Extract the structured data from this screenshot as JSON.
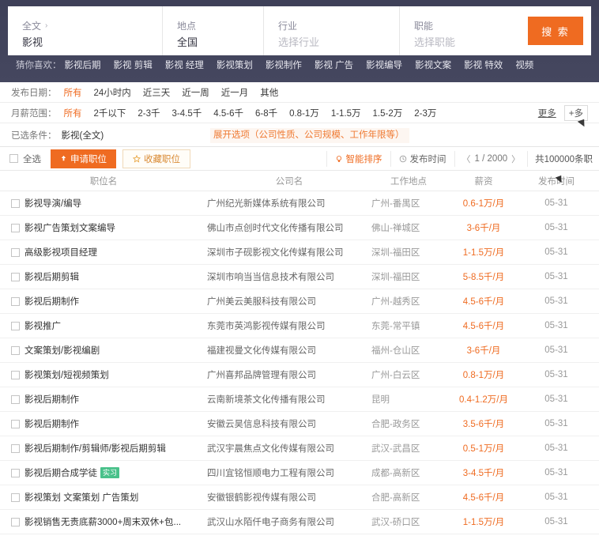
{
  "search": {
    "keyword_label": "全文",
    "keyword_chevron": "›",
    "keyword_value": "影视",
    "city_label": "地点",
    "city_value": "全国",
    "industry_label": "行业",
    "industry_placeholder": "选择行业",
    "function_label": "职能",
    "function_placeholder": "选择职能",
    "search_button": "搜 索",
    "accent_color": "#ef6b21",
    "header_bg": "#3e4058"
  },
  "hot": {
    "title": "猜你喜欢：",
    "items": [
      "影视后期",
      "影视 剪辑",
      "影视 经理",
      "影视策划",
      "影视制作",
      "影视 广告",
      "影视编导",
      "影视文案",
      "影视 特效",
      "视频"
    ]
  },
  "filters": {
    "date": {
      "label": "发布日期：",
      "options": [
        "所有",
        "24小时内",
        "近三天",
        "近一周",
        "近一月",
        "其他"
      ],
      "active": "所有"
    },
    "salary": {
      "label": "月薪范围：",
      "options": [
        "所有",
        "2千以下",
        "2-3千",
        "3-4.5千",
        "4.5-6千",
        "6-8千",
        "0.8-1万",
        "1-1.5万",
        "1.5-2万",
        "2-3万"
      ],
      "active": "所有",
      "more_label": "更多",
      "plus_label": "+多"
    },
    "tooltip": "展开选项（公司性质、公司规模、工作年限等）",
    "selected": {
      "label": "已选条件：",
      "tag": "影视(全文)"
    }
  },
  "actionbar": {
    "select_all": "全选",
    "apply_label": "申请职位",
    "apply_icon": "upload-icon",
    "favorite_label": "收藏职位",
    "favorite_icon": "star-icon",
    "smart_sort": "智能排序",
    "smart_sort_icon": "bulb-icon",
    "publish_time": "发布时间",
    "publish_time_icon": "clock-icon",
    "page_prev": "〈",
    "page_current": "1 / 2000",
    "page_next": "〉",
    "total": "共100000条职"
  },
  "table": {
    "columns": [
      "职位名",
      "公司名",
      "工作地点",
      "薪资",
      "发布时间"
    ],
    "rows": [
      {
        "title": "影视导演/编导",
        "company": "广州纪光新媒体系统有限公司",
        "location": "广州-番禺区",
        "salary": "0.6-1万/月",
        "date": "05-31",
        "badge": ""
      },
      {
        "title": "影视广告策划文案编导",
        "company": "佛山市点创时代文化传播有限公司",
        "location": "佛山-禅城区",
        "salary": "3-6千/月",
        "date": "05-31",
        "badge": ""
      },
      {
        "title": "高级影视项目经理",
        "company": "深圳市子砚影视文化传媒有限公司",
        "location": "深圳-福田区",
        "salary": "1-1.5万/月",
        "date": "05-31",
        "badge": ""
      },
      {
        "title": "影视后期剪辑",
        "company": "深圳市响当当信息技术有限公司",
        "location": "深圳-福田区",
        "salary": "5-8.5千/月",
        "date": "05-31",
        "badge": ""
      },
      {
        "title": "影视后期制作",
        "company": "广州美云美服科技有限公司",
        "location": "广州-越秀区",
        "salary": "4.5-6千/月",
        "date": "05-31",
        "badge": ""
      },
      {
        "title": "影视推广",
        "company": "东莞市英鸿影视传媒有限公司",
        "location": "东莞-常平镇",
        "salary": "4.5-6千/月",
        "date": "05-31",
        "badge": ""
      },
      {
        "title": "文案策划/影视编剧",
        "company": "福建视曼文化传媒有限公司",
        "location": "福州-仓山区",
        "salary": "3-6千/月",
        "date": "05-31",
        "badge": ""
      },
      {
        "title": "影视策划/短视频策划",
        "company": "广州喜邦品牌管理有限公司",
        "location": "广州-白云区",
        "salary": "0.8-1万/月",
        "date": "05-31",
        "badge": ""
      },
      {
        "title": "影视后期制作",
        "company": "云南新境茶文化传播有限公司",
        "location": "昆明",
        "salary": "0.4-1.2万/月",
        "date": "05-31",
        "badge": ""
      },
      {
        "title": "影视后期制作",
        "company": "安徽云昊信息科技有限公司",
        "location": "合肥-政务区",
        "salary": "3.5-6千/月",
        "date": "05-31",
        "badge": ""
      },
      {
        "title": "影视后期制作/剪辑师/影视后期剪辑",
        "company": "武汉宇晨焦点文化传媒有限公司",
        "location": "武汉-武昌区",
        "salary": "0.5-1万/月",
        "date": "05-31",
        "badge": ""
      },
      {
        "title": "影视后期合成学徒",
        "company": "四川宜铭恒顺电力工程有限公司",
        "location": "成都-高新区",
        "salary": "3-4.5千/月",
        "date": "05-31",
        "badge": "实习"
      },
      {
        "title": "影视策划 文案策划 广告策划",
        "company": "安徽银鹤影视传媒有限公司",
        "location": "合肥-高新区",
        "salary": "4.5-6千/月",
        "date": "05-31",
        "badge": ""
      },
      {
        "title": "影视销售无责底薪3000+周末双休+包...",
        "company": "武汉山水陌仟电子商务有限公司",
        "location": "武汉-硚口区",
        "salary": "1-1.5万/月",
        "date": "05-31",
        "badge": ""
      }
    ]
  }
}
